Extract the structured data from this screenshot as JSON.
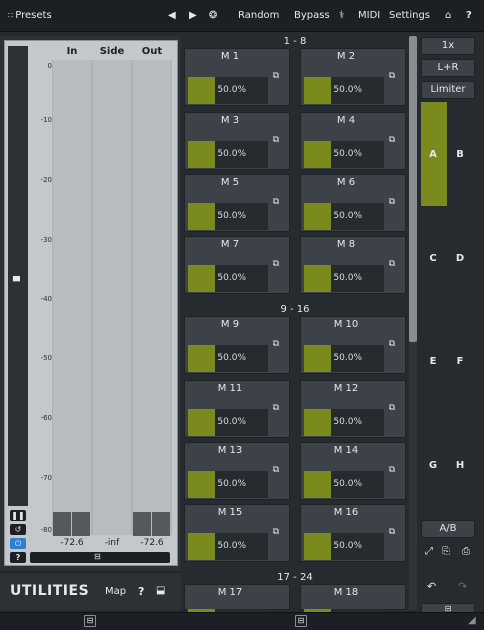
{
  "toolbar": {
    "presets_label": "Presets",
    "random_label": "Random",
    "bypass_label": "Bypass",
    "midi_label": "MIDI",
    "settings_label": "Settings",
    "help_label": "?"
  },
  "meter": {
    "channels": [
      "In",
      "Side",
      "Out"
    ],
    "scale": [
      "0",
      "-10",
      "-20",
      "-30",
      "-40",
      "-50",
      "-60",
      "-70",
      "-80"
    ],
    "peaks": [
      "-72.6",
      "-inf",
      "-72.6"
    ],
    "help_label": "?"
  },
  "utilities": {
    "title": "UTILITIES",
    "map_label": "Map",
    "help_label": "?"
  },
  "sections": [
    {
      "header": "1 - 8",
      "modulators": [
        {
          "label": "M 1",
          "value": "50.0%",
          "fraction": 0.5
        },
        {
          "label": "M 2",
          "value": "50.0%",
          "fraction": 0.5
        },
        {
          "label": "M 3",
          "value": "50.0%",
          "fraction": 0.5
        },
        {
          "label": "M 4",
          "value": "50.0%",
          "fraction": 0.5
        },
        {
          "label": "M 5",
          "value": "50.0%",
          "fraction": 0.5
        },
        {
          "label": "M 6",
          "value": "50.0%",
          "fraction": 0.5
        },
        {
          "label": "M 7",
          "value": "50.0%",
          "fraction": 0.5
        },
        {
          "label": "M 8",
          "value": "50.0%",
          "fraction": 0.5
        }
      ]
    },
    {
      "header": "9 - 16",
      "modulators": [
        {
          "label": "M 9",
          "value": "50.0%",
          "fraction": 0.5
        },
        {
          "label": "M 10",
          "value": "50.0%",
          "fraction": 0.5
        },
        {
          "label": "M 11",
          "value": "50.0%",
          "fraction": 0.5
        },
        {
          "label": "M 12",
          "value": "50.0%",
          "fraction": 0.5
        },
        {
          "label": "M 13",
          "value": "50.0%",
          "fraction": 0.5
        },
        {
          "label": "M 14",
          "value": "50.0%",
          "fraction": 0.5
        },
        {
          "label": "M 15",
          "value": "50.0%",
          "fraction": 0.5
        },
        {
          "label": "M 16",
          "value": "50.0%",
          "fraction": 0.5
        }
      ]
    },
    {
      "header": "17 - 24",
      "modulators": [
        {
          "label": "M 17",
          "value": "",
          "fraction": 0.5
        },
        {
          "label": "M 18",
          "value": "",
          "fraction": 0.5
        }
      ]
    }
  ],
  "right_panel": {
    "zoom_label": "1x",
    "channel_mode_label": "L+R",
    "limiter_label": "Limiter",
    "slots": [
      "A",
      "B",
      "C",
      "D",
      "E",
      "F",
      "G",
      "H"
    ],
    "ab_label": "A/B"
  },
  "colors": {
    "accent_fill": "#7a8a1c",
    "active_slot": "#7a8a1c",
    "meter_bg": "#c5c8cb",
    "power_blue": "#2f7fd0"
  }
}
